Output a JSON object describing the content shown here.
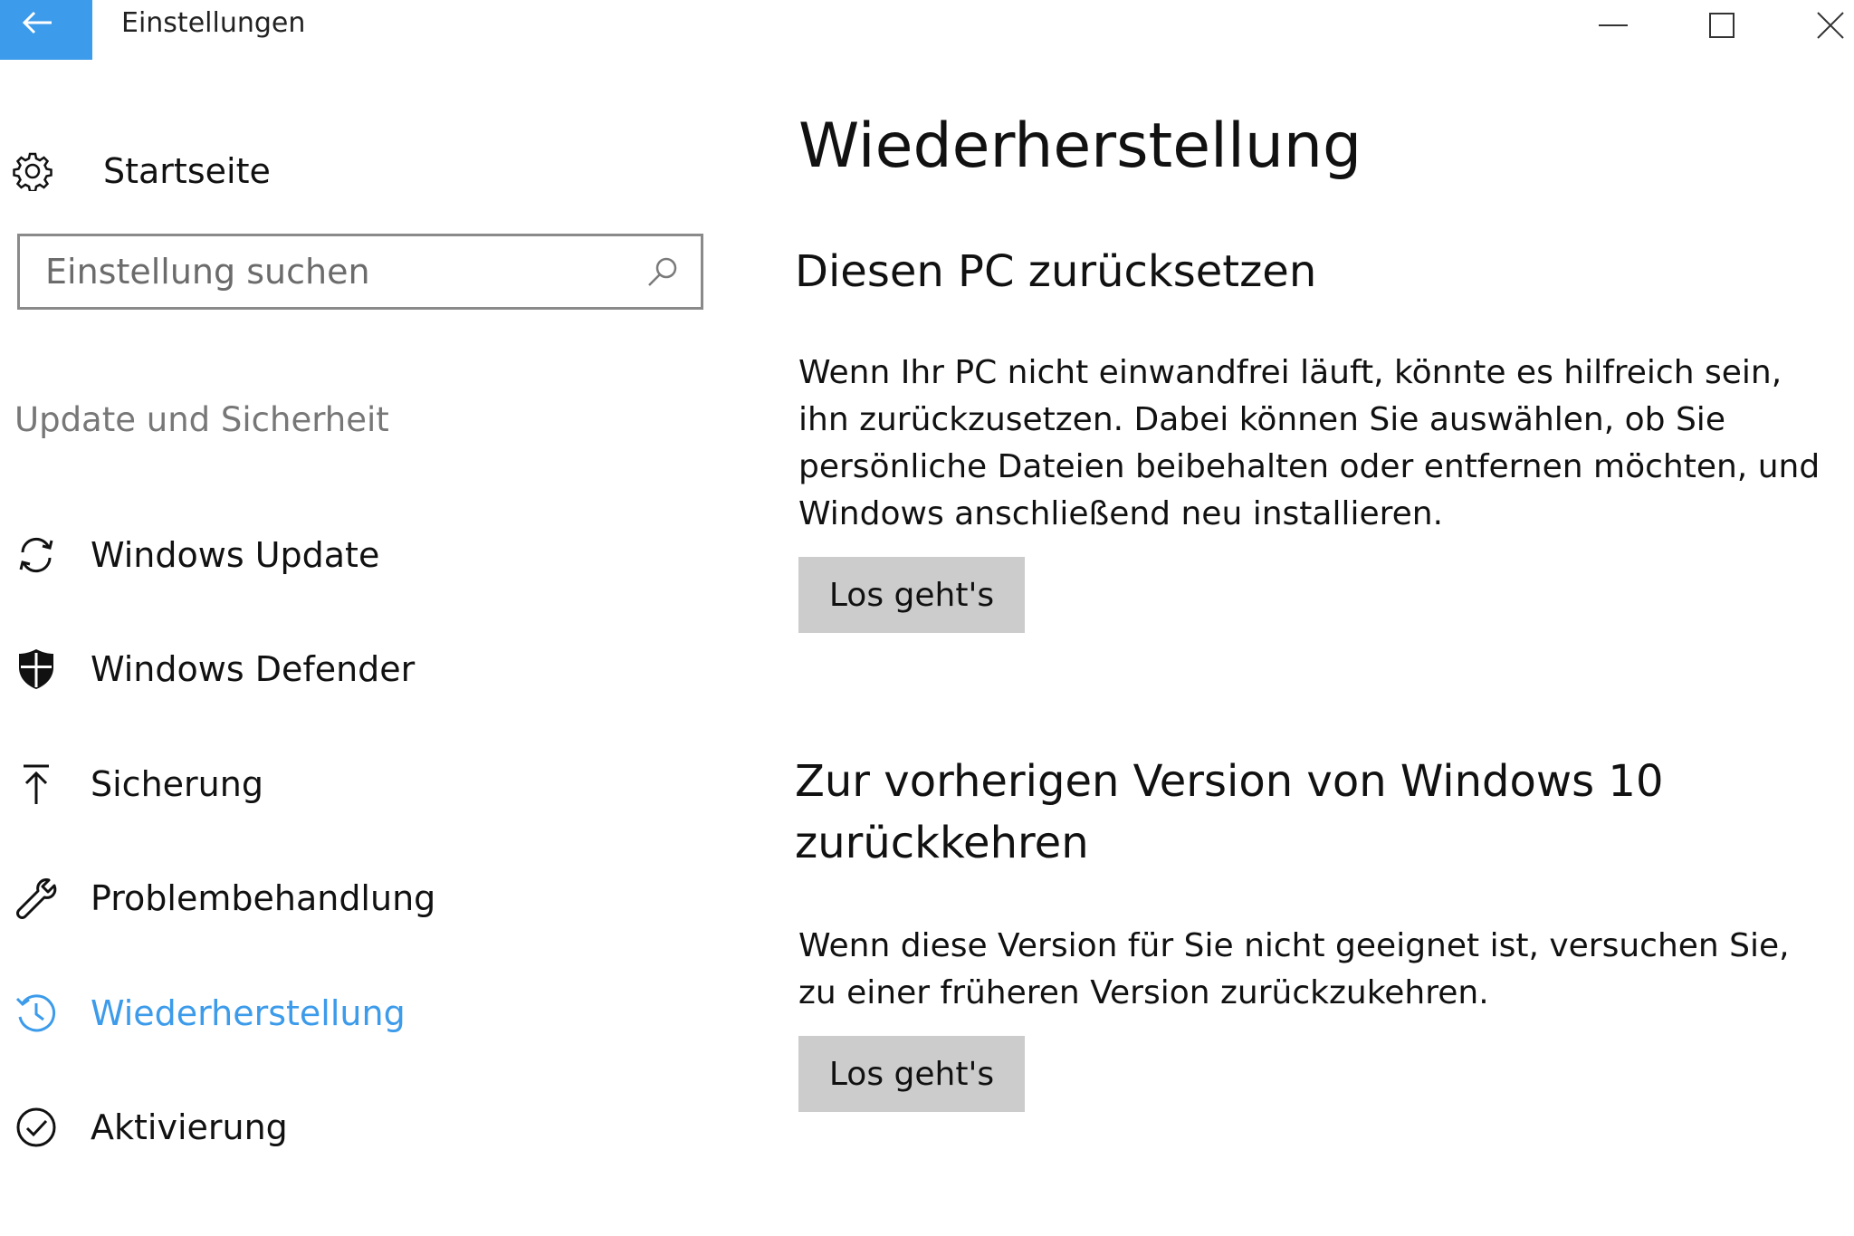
{
  "window": {
    "title": "Einstellungen"
  },
  "sidebar": {
    "home_label": "Startseite",
    "search_placeholder": "Einstellung suchen",
    "section_heading": "Update und Sicherheit",
    "items": [
      {
        "label": "Windows Update",
        "icon": "sync-icon"
      },
      {
        "label": "Windows Defender",
        "icon": "shield-icon"
      },
      {
        "label": "Sicherung",
        "icon": "upload-arrow-icon"
      },
      {
        "label": "Problembehandlung",
        "icon": "wrench-icon"
      },
      {
        "label": "Wiederherstellung",
        "icon": "history-icon",
        "active": true
      },
      {
        "label": "Aktivierung",
        "icon": "check-circle-icon"
      }
    ]
  },
  "content": {
    "page_title": "Wiederherstellung",
    "sections": [
      {
        "title": "Diesen PC zurücksetzen",
        "text": "Wenn Ihr PC nicht einwandfrei läuft, könnte es hilfreich sein, ihn zurückzusetzen. Dabei können Sie auswählen, ob Sie persönliche Dateien beibehalten oder entfernen möchten, und Windows anschließend neu installieren.",
        "button": "Los geht's"
      },
      {
        "title": "Zur vorherigen Version von Windows 10 zurückkehren",
        "text": "Wenn diese Version für Sie nicht geeignet ist, versuchen Sie, zu einer früheren Version zurückzukehren.",
        "button": "Los geht's"
      }
    ]
  },
  "colors": {
    "accent": "#3c9bea",
    "button_bg": "#cccccc",
    "section_heading": "#777777"
  }
}
